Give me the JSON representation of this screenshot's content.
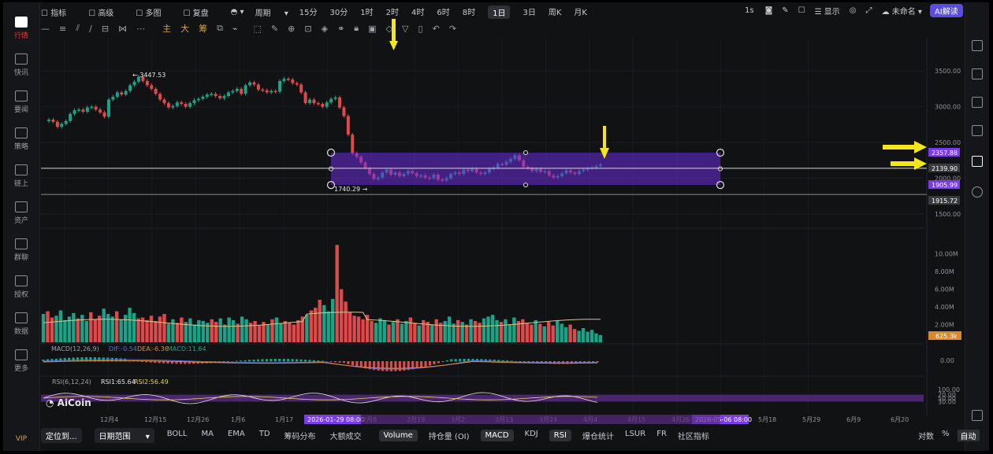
{
  "sidebar": {
    "items": [
      {
        "label": "行情",
        "icon": "chart-icon",
        "active": true
      },
      {
        "label": "快讯",
        "icon": "news-icon"
      },
      {
        "label": "要闻",
        "icon": "document-icon"
      },
      {
        "label": "策略",
        "icon": "robot-icon"
      },
      {
        "label": "链上",
        "icon": "chain-icon"
      },
      {
        "label": "资产",
        "icon": "wallet-icon"
      },
      {
        "label": "群聊",
        "icon": "chat-icon"
      },
      {
        "label": "授权",
        "icon": "key-icon"
      },
      {
        "label": "数据",
        "icon": "database-icon"
      },
      {
        "label": "更多",
        "icon": "grid-icon"
      }
    ],
    "vip": "VIP"
  },
  "toolbar": {
    "items": [
      "指标",
      "高级",
      "多图",
      "复盘"
    ],
    "period_label": "周期",
    "intervals": [
      "15分",
      "30分",
      "1时",
      "2时",
      "4时",
      "6时",
      "8时",
      "1日",
      "3日",
      "周K",
      "月K"
    ],
    "selected_interval": "1日",
    "right": {
      "seconds": "1s",
      "display": "显示",
      "layout_name": "未命名",
      "ai_button": "AI解读"
    }
  },
  "drawing_toolbar": {
    "main": "主",
    "big": "大",
    "chip": "筹"
  },
  "bottom_bar": {
    "locate": "定位到...",
    "date_range": "日期范围",
    "indicators": [
      "BOLL",
      "MA",
      "EMA",
      "TD",
      "筹码分布",
      "大额成交"
    ],
    "sub_indicators": [
      "Volume",
      "持仓量 (OI)",
      "MACD",
      "KDJ",
      "RSI",
      "爆仓统计",
      "LSUR",
      "FR",
      "社区指标"
    ],
    "active_sub": [
      "Volume",
      "MACD",
      "RSI"
    ],
    "right": {
      "log": "对数",
      "percent": "%",
      "auto": "自动"
    }
  },
  "logo_text": "AiCoin",
  "colors": {
    "up": "#1aa386",
    "down": "#e0494a",
    "box": "#6b2bd9",
    "accent": "#f3e61c"
  },
  "chart_data": [
    {
      "type": "candlestick",
      "name": "price",
      "ylim": [
        1500,
        3700
      ],
      "y_ticks": [
        "3500.00",
        "3000.00",
        "2500.00",
        "2000.00",
        "1500.00"
      ],
      "x_ticks": [
        "12月4",
        "12月15",
        "12月26",
        "1月6",
        "1月17",
        "2月8",
        "2月19",
        "3月2",
        "3月13",
        "3月24",
        "4月4",
        "4月15",
        "4月26",
        "5月18",
        "5月29",
        "6月9",
        "6月20"
      ],
      "x_highlight_labels": [
        "2026-01-29 08:00",
        "2026-05-06 08:00"
      ],
      "annotations": {
        "high": "← 3447.53",
        "low": "1740.29 →"
      },
      "price_labels": [
        "2357.88",
        "2139.90",
        "1905.99",
        "1915.72"
      ],
      "range_box": {
        "top": 2357.88,
        "bottom": 1905.99
      },
      "closes": [
        2820,
        2790,
        2720,
        2760,
        2800,
        2900,
        2950,
        2960,
        2930,
        2990,
        3000,
        2960,
        2920,
        2860,
        3100,
        3140,
        3200,
        3170,
        3220,
        3300,
        3350,
        3420,
        3360,
        3300,
        3250,
        3180,
        3100,
        3050,
        2990,
        3010,
        3060,
        3040,
        3000,
        3050,
        3090,
        3110,
        3140,
        3170,
        3180,
        3150,
        3120,
        3150,
        3200,
        3220,
        3250,
        3180,
        3300,
        3340,
        3310,
        3240,
        3230,
        3200,
        3220,
        3210,
        3360,
        3390,
        3380,
        3330,
        3310,
        3200,
        3050,
        3100,
        3050,
        3040,
        3000,
        3060,
        3110,
        3130,
        2990,
        2870,
        2610,
        2350,
        2300,
        2220,
        2140,
        2060,
        1990,
        2010,
        2080,
        2120,
        2050,
        2080,
        2030,
        2060,
        2100,
        2070,
        2030,
        2040,
        2010,
        2000,
        2050,
        1980,
        1970,
        2000,
        2060,
        2080,
        2060,
        2120,
        2100,
        2130,
        2080,
        2060,
        2080,
        2130,
        2150,
        2200,
        2190,
        2230,
        2270,
        2320,
        2250,
        2160,
        2140,
        2100,
        2130,
        2090,
        2100,
        2040,
        2010,
        2030,
        2070,
        2110,
        2080,
        2060,
        2100,
        2120,
        2140,
        2150,
        2170,
        2190
      ],
      "opens": [
        2800,
        2820,
        2790,
        2720,
        2760,
        2800,
        2900,
        2950,
        2960,
        2930,
        2990,
        3000,
        2960,
        2920,
        2860,
        3100,
        3140,
        3200,
        3170,
        3220,
        3300,
        3350,
        3420,
        3360,
        3300,
        3250,
        3180,
        3100,
        3050,
        2990,
        3010,
        3060,
        3040,
        3000,
        3050,
        3090,
        3110,
        3140,
        3170,
        3180,
        3150,
        3120,
        3150,
        3200,
        3220,
        3250,
        3180,
        3300,
        3340,
        3310,
        3240,
        3230,
        3200,
        3220,
        3210,
        3360,
        3390,
        3380,
        3330,
        3310,
        3200,
        3050,
        3100,
        3050,
        3040,
        3000,
        3060,
        3110,
        3130,
        2990,
        2870,
        2610,
        2350,
        2300,
        2220,
        2140,
        2060,
        1990,
        2010,
        2080,
        2120,
        2050,
        2080,
        2030,
        2060,
        2100,
        2070,
        2030,
        2040,
        2010,
        2000,
        2050,
        1980,
        1970,
        2000,
        2060,
        2080,
        2060,
        2120,
        2100,
        2130,
        2080,
        2060,
        2080,
        2130,
        2150,
        2200,
        2190,
        2230,
        2270,
        2320,
        2250,
        2160,
        2140,
        2100,
        2130,
        2090,
        2100,
        2040,
        2010,
        2030,
        2070,
        2110,
        2080,
        2060,
        2100,
        2120,
        2140,
        2150,
        2170
      ]
    },
    {
      "type": "bar",
      "name": "Volume",
      "ylim": [
        0,
        12000000
      ],
      "y_ticks": [
        "10.00M",
        "8.00M",
        "6.00M",
        "4.00M",
        "2.00M"
      ],
      "last_value_label": "625.3k",
      "values": [
        3.2,
        3.5,
        2.8,
        3.0,
        3.6,
        2.5,
        2.9,
        3.3,
        2.7,
        3.1,
        2.4,
        3.4,
        2.6,
        3.0,
        3.8,
        3.2,
        2.9,
        3.5,
        2.6,
        3.1,
        3.9,
        3.3,
        2.7,
        2.8,
        2.5,
        3.0,
        2.4,
        2.9,
        3.2,
        2.1,
        2.6,
        2.2,
        2.8,
        2.3,
        2.7,
        2.0,
        2.5,
        2.4,
        2.2,
        2.6,
        2.3,
        2.7,
        2.0,
        2.8,
        2.5,
        2.1,
        2.9,
        2.6,
        2.2,
        2.4,
        1.9,
        2.3,
        2.0,
        2.6,
        2.8,
        2.1,
        2.4,
        2.2,
        2.0,
        2.5,
        2.9,
        3.1,
        3.6,
        3.9,
        4.8,
        4.2,
        3.5,
        4.9,
        11.0,
        6.0,
        4.6,
        3.4,
        3.0,
        2.9,
        2.6,
        3.1,
        2.4,
        2.2,
        2.7,
        2.5,
        2.0,
        2.3,
        2.6,
        2.1,
        2.4,
        2.8,
        2.2,
        1.9,
        2.5,
        2.3,
        2.0,
        2.6,
        2.2,
        2.4,
        2.9,
        2.1,
        2.5,
        2.3,
        2.0,
        2.6,
        2.4,
        2.2,
        2.7,
        2.9,
        3.1,
        2.5,
        2.3,
        2.6,
        2.0,
        2.8,
        2.4,
        2.6,
        2.2,
        2.0,
        2.5,
        2.1,
        1.8,
        2.3,
        1.9,
        2.4,
        2.1,
        1.7,
        2.0,
        1.5,
        1.3,
        1.6,
        1.2,
        1.4,
        1.0,
        0.8
      ]
    },
    {
      "type": "line",
      "name": "MACD",
      "legend": {
        "title": "MACD(12,26,9)",
        "dif": "DIF:-0.54",
        "dea": "DEA:-6.36",
        "macd": "MACD:11.64"
      },
      "y_ticks": [
        "0.00"
      ],
      "ylim": [
        -150,
        100
      ]
    },
    {
      "type": "line",
      "name": "RSI",
      "legend": {
        "title": "RSI(6,12,24)",
        "rsi1": "RSI1:65.64",
        "rsi2": "RSI2:56.49"
      },
      "y_ticks": [
        "100.00",
        "70.00",
        "50.00",
        "30.00"
      ],
      "ylim": [
        0,
        100
      ]
    }
  ]
}
